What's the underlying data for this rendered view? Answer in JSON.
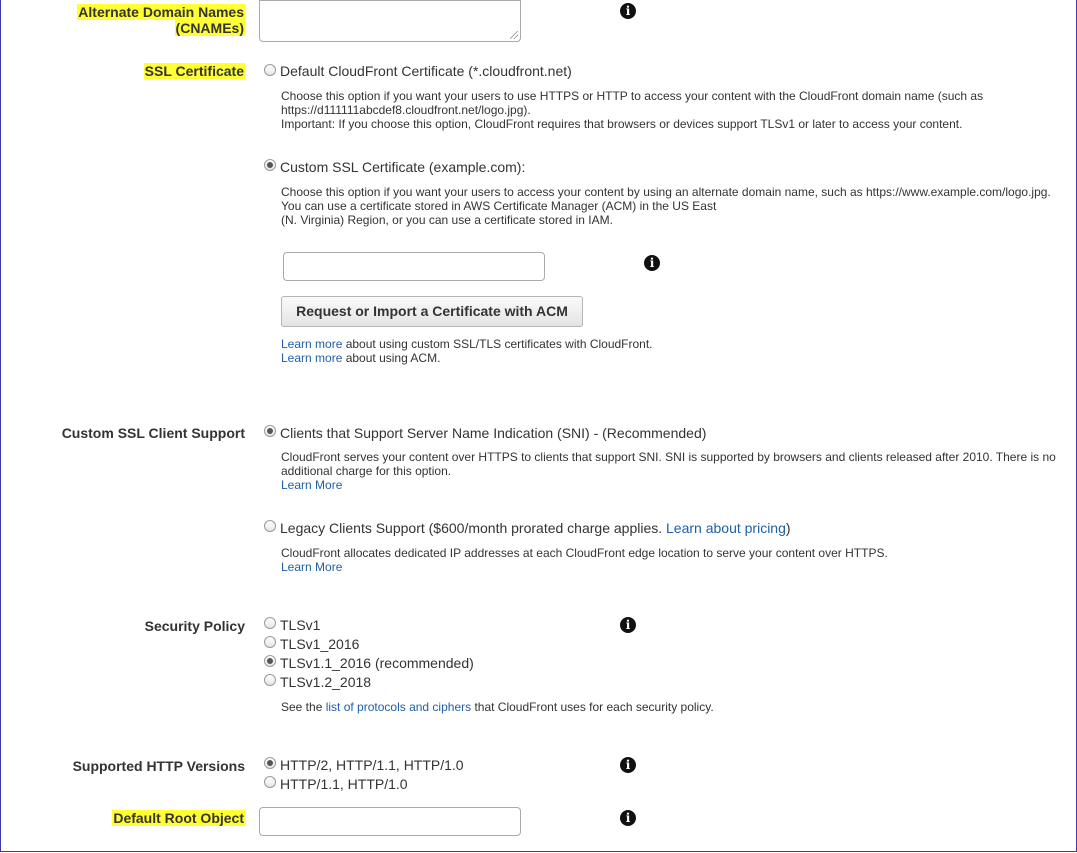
{
  "cnames": {
    "label_line1": "Alternate Domain Names",
    "label_line2": "(CNAMEs)"
  },
  "ssl_certificate": {
    "label": "SSL Certificate",
    "default_option": "Default CloudFront Certificate (*.cloudfront.net)",
    "default_desc_line1": "Choose this option if you want your users to use HTTPS or HTTP to access your content with the CloudFront domain name (such as",
    "default_desc_line2": "https://d111111abcdef8.cloudfront.net/logo.jpg).",
    "default_desc_line3": "Important: If you choose this option, CloudFront requires that browsers or devices support TLSv1 or later to access your content.",
    "custom_option": "Custom SSL Certificate (example.com):",
    "custom_desc_line1": "Choose this option if you want your users to access your content by using an alternate domain name, such as https://www.example.com/logo.jpg.",
    "custom_desc_line2": "You can use a certificate stored in AWS Certificate Manager (ACM) in the US East",
    "custom_desc_line3": "(N. Virginia) Region, or you can use a certificate stored in IAM.",
    "certificate_input_value": "",
    "request_button": "Request or Import a Certificate with ACM",
    "learn_more_link1": "Learn more",
    "learn_more_text1": " about using custom SSL/TLS certificates with CloudFront.",
    "learn_more_link2": "Learn more",
    "learn_more_text2": " about using ACM."
  },
  "client_support": {
    "label": "Custom SSL Client Support",
    "sni_option": "Clients that Support Server Name Indication (SNI) - (Recommended)",
    "sni_desc_line1": "CloudFront serves your content over HTTPS to clients that support SNI. SNI is supported by browsers and clients released after 2010. There is no",
    "sni_desc_line2": "additional charge for this option.",
    "sni_learn_more": "Learn More",
    "legacy_option": "Legacy Clients Support ($600/month prorated charge applies. ",
    "legacy_pricing_link": "Learn about pricing",
    "legacy_option_end": ")",
    "legacy_desc": "CloudFront allocates dedicated IP addresses at each CloudFront edge location to serve your content over HTTPS.",
    "legacy_learn_more": "Learn More"
  },
  "security_policy": {
    "label": "Security Policy",
    "options": [
      "TLSv1",
      "TLSv1_2016",
      "TLSv1.1_2016 (recommended)",
      "TLSv1.2_2018"
    ],
    "selected": "TLSv1.1_2016 (recommended)",
    "see_text": "See the ",
    "protocols_link": "list of protocols and ciphers",
    "see_text_end": " that CloudFront uses for each security policy."
  },
  "http_versions": {
    "label": "Supported HTTP Versions",
    "options": [
      "HTTP/2, HTTP/1.1, HTTP/1.0",
      "HTTP/1.1, HTTP/1.0"
    ],
    "selected": "HTTP/2, HTTP/1.1, HTTP/1.0"
  },
  "default_root": {
    "label": "Default Root Object",
    "value": ""
  },
  "icons": {
    "info": "i"
  },
  "colors": {
    "highlight": "#ffff33",
    "link": "#1f5fa8"
  }
}
